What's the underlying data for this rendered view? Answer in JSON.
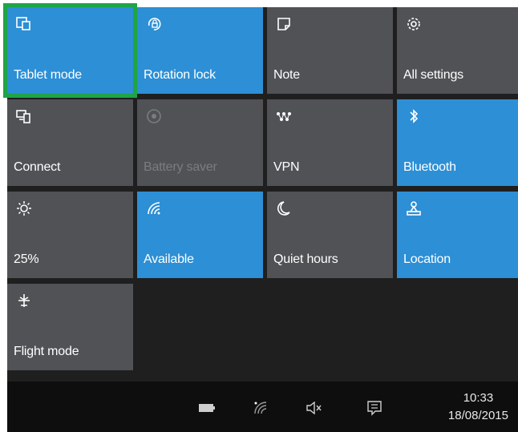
{
  "tiles": [
    {
      "label": "Tablet mode",
      "icon": "tablet-mode-icon",
      "state": "on"
    },
    {
      "label": "Rotation lock",
      "icon": "rotation-lock-icon",
      "state": "on"
    },
    {
      "label": "Note",
      "icon": "note-icon",
      "state": "off"
    },
    {
      "label": "All settings",
      "icon": "gear-icon",
      "state": "off"
    },
    {
      "label": "Connect",
      "icon": "connect-icon",
      "state": "off"
    },
    {
      "label": "Battery saver",
      "icon": "battery-saver-icon",
      "state": "disabled"
    },
    {
      "label": "VPN",
      "icon": "vpn-icon",
      "state": "off"
    },
    {
      "label": "Bluetooth",
      "icon": "bluetooth-icon",
      "state": "on"
    },
    {
      "label": "25%",
      "icon": "brightness-icon",
      "state": "off"
    },
    {
      "label": "Available",
      "icon": "wifi-icon",
      "state": "on"
    },
    {
      "label": "Quiet hours",
      "icon": "moon-icon",
      "state": "off"
    },
    {
      "label": "Location",
      "icon": "location-icon",
      "state": "on"
    },
    {
      "label": "Flight mode",
      "icon": "airplane-icon",
      "state": "off"
    }
  ],
  "taskbar": {
    "icons": [
      "battery-icon",
      "wifi-icon",
      "speaker-muted-icon",
      "action-center-icon"
    ],
    "time": "10:33",
    "date": "18/08/2015"
  },
  "colors": {
    "on": "#2d8fd5",
    "off": "#505256",
    "selected_outline": "#1fa446",
    "background": "#1f1f1f",
    "taskbar": "#0e0e0e"
  }
}
